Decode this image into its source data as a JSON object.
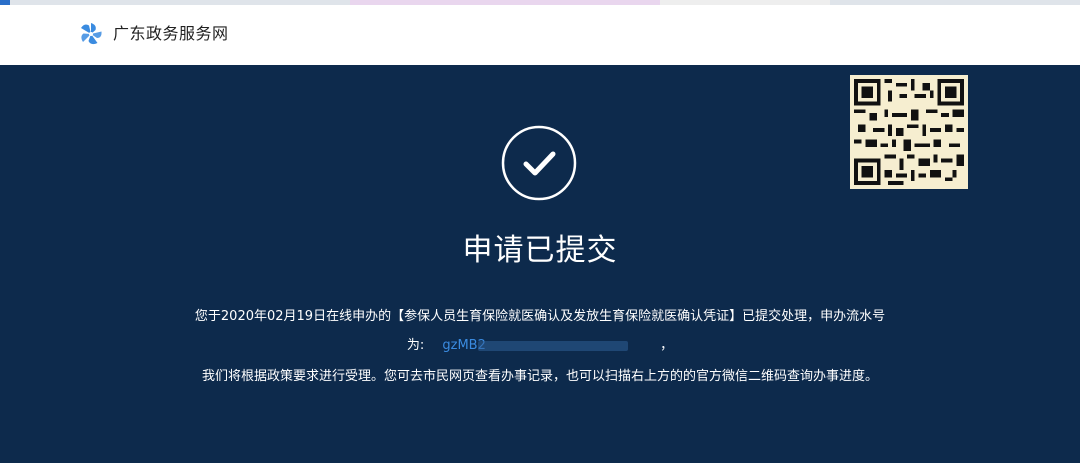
{
  "header": {
    "site_name": "广东政务服务网",
    "logo_icon": "pinwheel-logo-icon",
    "brand_color": "#3a8be0"
  },
  "main": {
    "background_color": "#0d2a4c",
    "status_icon": "check-circle-icon",
    "title": "申请已提交",
    "message_line1": "您于2020年02月19日在线申办的【参保人员生育保险就医确认及发放生育保险就医确认凭证】已提交处理，申办流水号",
    "serial_prefix": "为:",
    "serial_number": "gzMB2",
    "serial_suffix": "，",
    "message_line3": "我们将根据政策要求进行受理。您可去市民网页查看办事记录，也可以扫描右上方的的官方微信二维码查询办事进度。",
    "qr_icon": "qr-code-icon"
  }
}
